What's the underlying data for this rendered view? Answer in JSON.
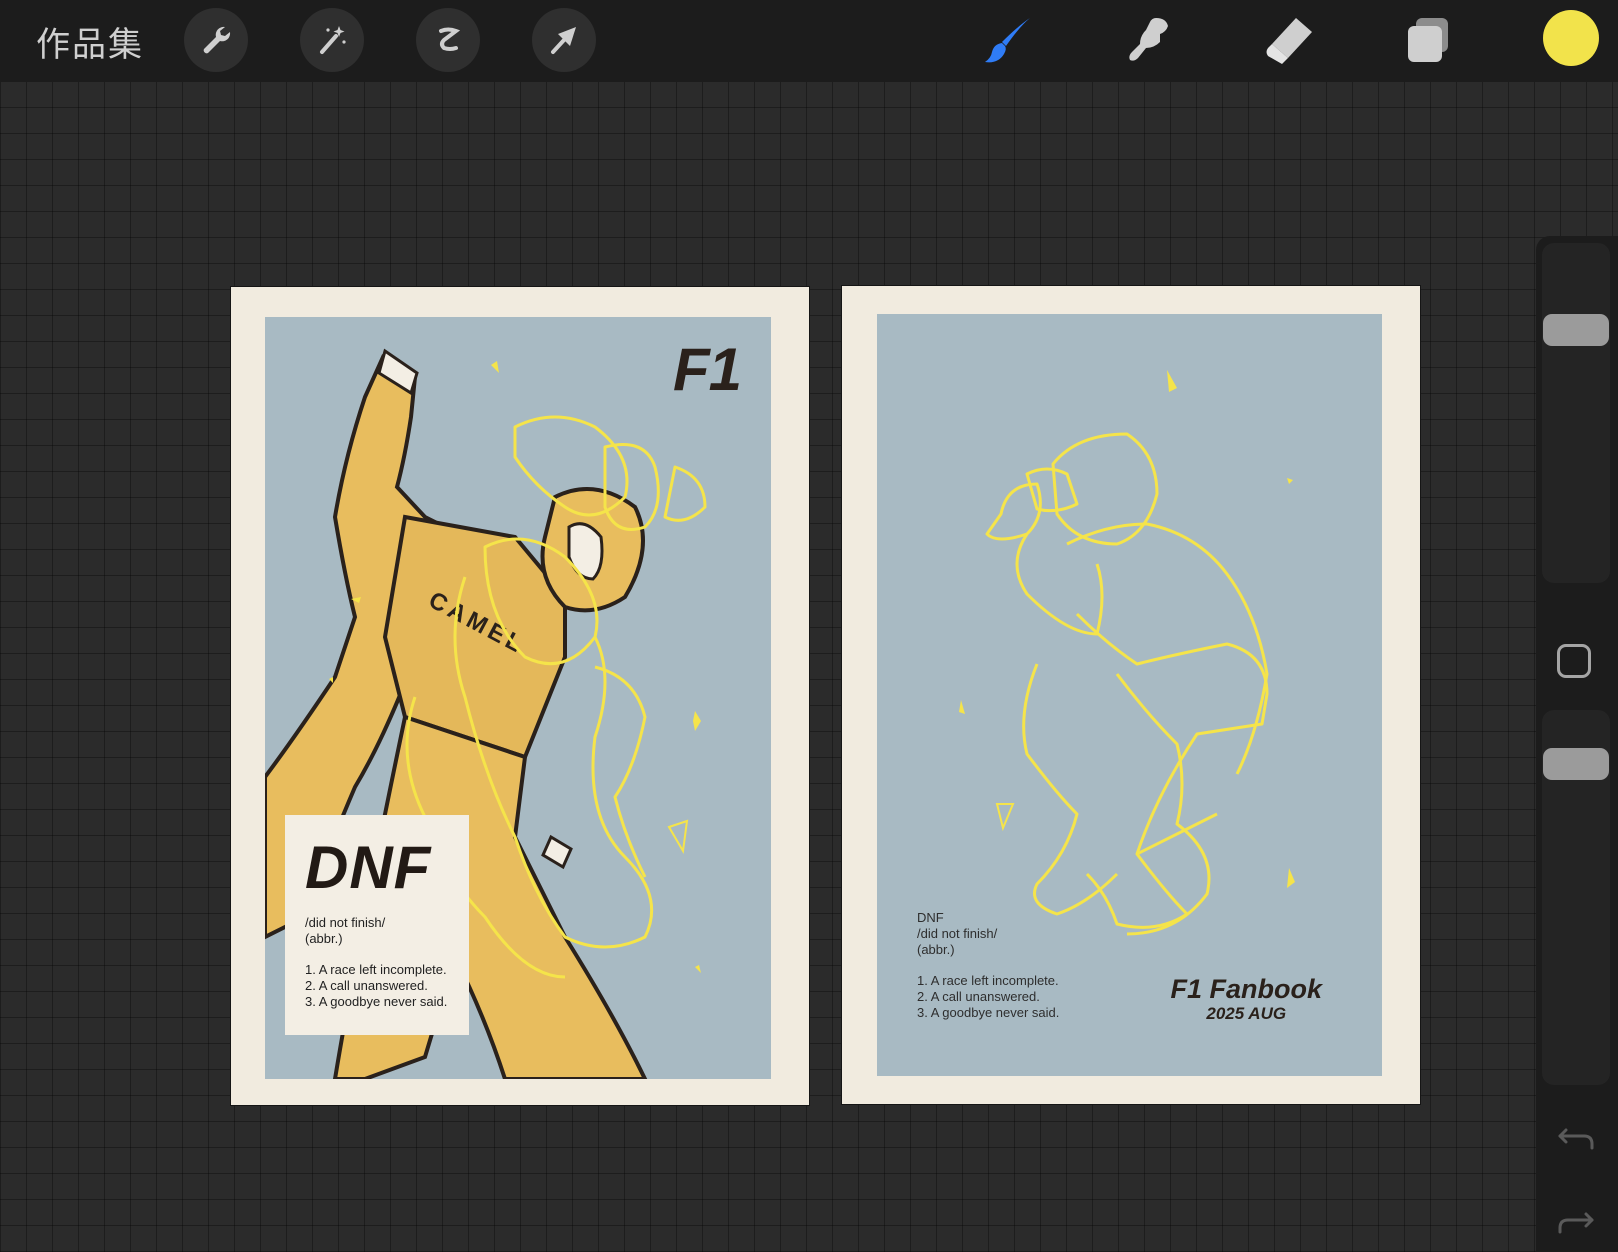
{
  "toolbar": {
    "gallery_label": "作品集",
    "left_tools": [
      "wrench-icon",
      "magic-wand-icon",
      "selection-s-icon",
      "transform-arrow-icon"
    ],
    "right_tools": [
      "brush-icon",
      "smudge-icon",
      "eraser-icon",
      "layers-icon"
    ],
    "active_tool": "brush-icon",
    "active_color": "#f2e34b",
    "accent": "#2f7cf6"
  },
  "canvas": {
    "left_page": {
      "title": "F1",
      "jersey_text": "CAMEL",
      "definition": {
        "word": "DNF",
        "pronunciation": "/did not finish/",
        "pos": "(abbr.)",
        "senses": [
          "1. A race left incomplete.",
          "2. A call unanswered.",
          "3. A goodbye never said."
        ]
      }
    },
    "right_page": {
      "definition": {
        "word": "DNF",
        "pronunciation": "/did not finish/",
        "pos": "(abbr.)",
        "senses": [
          "1. A race left incomplete.",
          "2. A call unanswered.",
          "3. A goodbye never said."
        ]
      },
      "book_title": "F1 Fanbook",
      "book_date": "2025 AUG"
    },
    "colors": {
      "paper": "#f1ebdf",
      "panel": "#a8bac3",
      "suit": "#e8bd5e",
      "line": "#f5e44a",
      "ink": "#2a211b"
    }
  },
  "sidebar": {
    "controls": [
      "brush-size-slider",
      "modify-button",
      "opacity-slider",
      "undo-icon",
      "redo-icon"
    ]
  }
}
